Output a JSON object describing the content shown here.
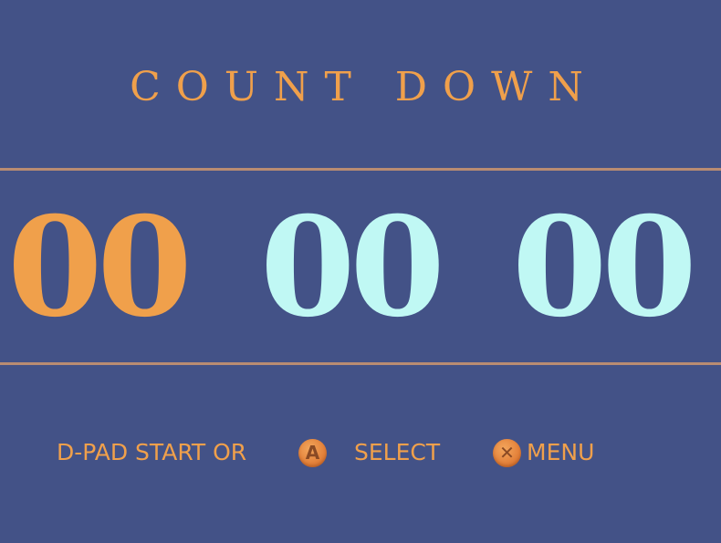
{
  "screen": {
    "title": "COUNT DOWN",
    "colors": {
      "background": "#435287",
      "accent": "#f0a04b",
      "inactive_digits": "#c0f8f4",
      "rule": "#b98c72"
    }
  },
  "timer": {
    "hours": "00",
    "minutes": "00",
    "seconds": "00",
    "selected_segment": "hours"
  },
  "controls": {
    "dpad_label": "D-PAD START OR",
    "a_button_glyph": "A",
    "select_label": "SELECT",
    "x_button_glyph": "✕",
    "menu_label": "MENU"
  }
}
